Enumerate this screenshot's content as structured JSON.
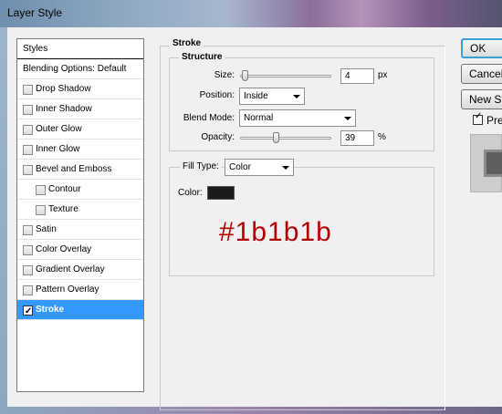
{
  "window": {
    "title": "Layer Style"
  },
  "styles_list": {
    "header": "Styles",
    "items": [
      {
        "label": "Blending Options: Default",
        "checkbox": false,
        "checked": false,
        "indent": 0,
        "selected": false
      },
      {
        "label": "Drop Shadow",
        "checkbox": true,
        "checked": false,
        "indent": 0,
        "selected": false
      },
      {
        "label": "Inner Shadow",
        "checkbox": true,
        "checked": false,
        "indent": 0,
        "selected": false
      },
      {
        "label": "Outer Glow",
        "checkbox": true,
        "checked": false,
        "indent": 0,
        "selected": false
      },
      {
        "label": "Inner Glow",
        "checkbox": true,
        "checked": false,
        "indent": 0,
        "selected": false
      },
      {
        "label": "Bevel and Emboss",
        "checkbox": true,
        "checked": false,
        "indent": 0,
        "selected": false
      },
      {
        "label": "Contour",
        "checkbox": true,
        "checked": false,
        "indent": 1,
        "selected": false
      },
      {
        "label": "Texture",
        "checkbox": true,
        "checked": false,
        "indent": 1,
        "selected": false
      },
      {
        "label": "Satin",
        "checkbox": true,
        "checked": false,
        "indent": 0,
        "selected": false
      },
      {
        "label": "Color Overlay",
        "checkbox": true,
        "checked": false,
        "indent": 0,
        "selected": false
      },
      {
        "label": "Gradient Overlay",
        "checkbox": true,
        "checked": false,
        "indent": 0,
        "selected": false
      },
      {
        "label": "Pattern Overlay",
        "checkbox": true,
        "checked": false,
        "indent": 0,
        "selected": false
      },
      {
        "label": "Stroke",
        "checkbox": true,
        "checked": true,
        "indent": 0,
        "selected": true
      }
    ]
  },
  "stroke": {
    "title": "Stroke",
    "structure": {
      "title": "Structure",
      "size_label": "Size:",
      "size_value": "4",
      "size_unit": "px",
      "size_slider_fraction": 0.02,
      "position_label": "Position:",
      "position_value": "Inside",
      "blend_mode_label": "Blend Mode:",
      "blend_mode_value": "Normal",
      "opacity_label": "Opacity:",
      "opacity_value": "39",
      "opacity_unit": "%",
      "opacity_slider_fraction": 0.39
    },
    "fill": {
      "fill_type_label": "Fill Type:",
      "fill_type_value": "Color",
      "color_label": "Color:",
      "color_hex": "#1b1b1b"
    },
    "annotation": "#1b1b1b"
  },
  "buttons": {
    "ok": "OK",
    "cancel": "Cancel",
    "new_style": "New Style...",
    "preview_label": "Preview",
    "preview_checked": true
  },
  "colors": {
    "selection": "#3399ff",
    "annotation": "#b30000",
    "swatch": "#1b1b1b"
  }
}
